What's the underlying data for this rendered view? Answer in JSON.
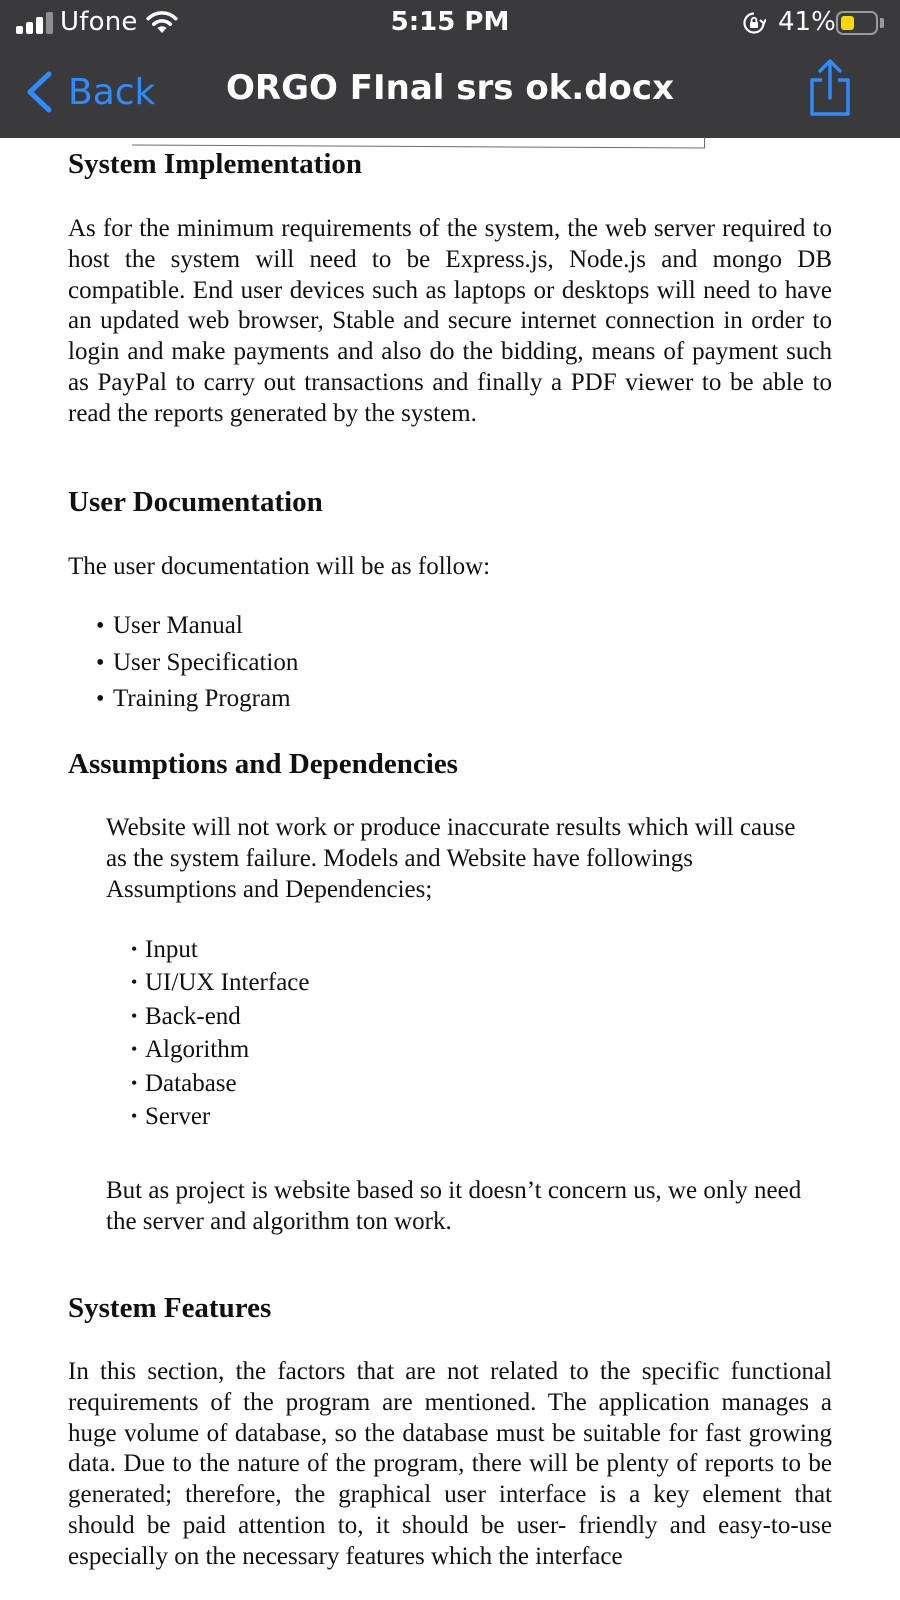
{
  "status_bar": {
    "carrier": "Ufone",
    "time": "5:15 PM",
    "battery_percent_label": "41%",
    "battery_level": 0.41
  },
  "nav": {
    "back_label": "Back",
    "title": "ORGO FInal srs ok.docx"
  },
  "colors": {
    "chrome_bg": "#3a3a3c",
    "accent_blue": "#2f8cff",
    "battery_yellow": "#ffd60a"
  },
  "document": {
    "system_implementation": {
      "heading": "System Implementation",
      "body": "As for the minimum requirements of the system, the web server required to host the system will need to be Express.js, Node.js and mongo DB compatible. End user devices such as laptops or desktops will need to have an updated web browser, Stable and secure internet connection in order to login and make payments and also do the bidding, means of payment such as PayPal to carry out transactions and finally a PDF viewer to be able to read the reports generated by the system."
    },
    "user_documentation": {
      "heading": "User Documentation",
      "intro": "The user documentation will be as follow:",
      "items": [
        "User Manual",
        "User Specification",
        "Training Program"
      ]
    },
    "assumptions": {
      "heading": "Assumptions and Dependencies",
      "body": "Website will not work or produce inaccurate results which will cause as the system failure. Models and Website have followings Assumptions and Dependencies;",
      "items": [
        "Input",
        "UI/UX Interface",
        "Back-end",
        "Algorithm",
        "Database",
        "Server"
      ],
      "closing": "But as project is website based so it doesn’t concern us, we only need the server and algorithm ton work."
    },
    "system_features": {
      "heading": "System Features",
      "body": "In this section, the factors that are not related to the specific functional requirements of the program are mentioned. The application manages a huge volume of database, so the database must be suitable for fast growing data. Due to the nature of the program, there will be plenty of reports to be generated; therefore, the graphical user interface is a key element that should be paid attention to, it should be user- friendly and easy-to-use especially on the necessary features which the interface"
    }
  }
}
